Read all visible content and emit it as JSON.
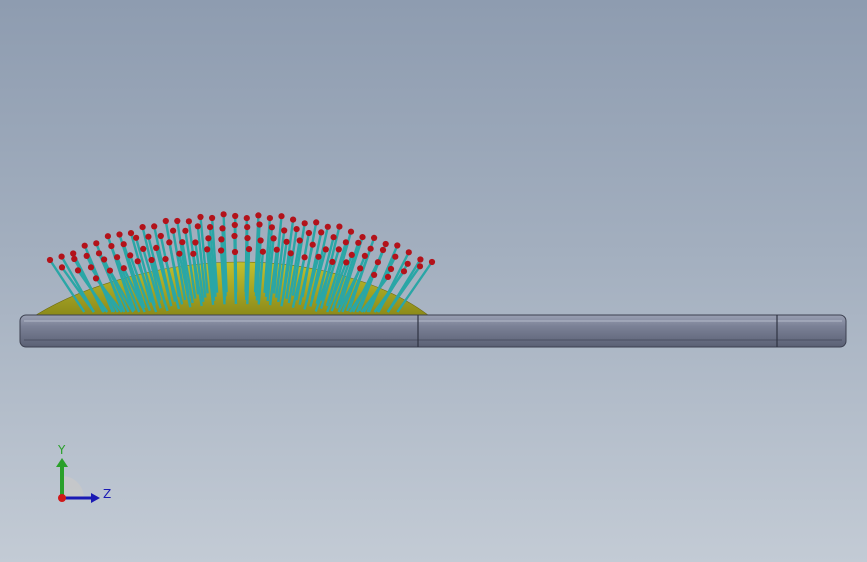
{
  "colors": {
    "background_top": "#8e9cb0",
    "background_bottom": "#c3cbd5",
    "handle": "#757b90",
    "handle_edge": "#3c4050",
    "cushion": "#a8a623",
    "bristle": "#2aa6a6",
    "tip": "#b3121a",
    "axis_y": "#2aa02a",
    "axis_z": "#1a1ab4",
    "axis_origin": "#d01818"
  },
  "triad": {
    "y_label": "Y",
    "z_label": "Z",
    "icons": [
      "y-axis-arrow-icon",
      "z-axis-arrow-icon",
      "origin-dot-icon"
    ]
  }
}
